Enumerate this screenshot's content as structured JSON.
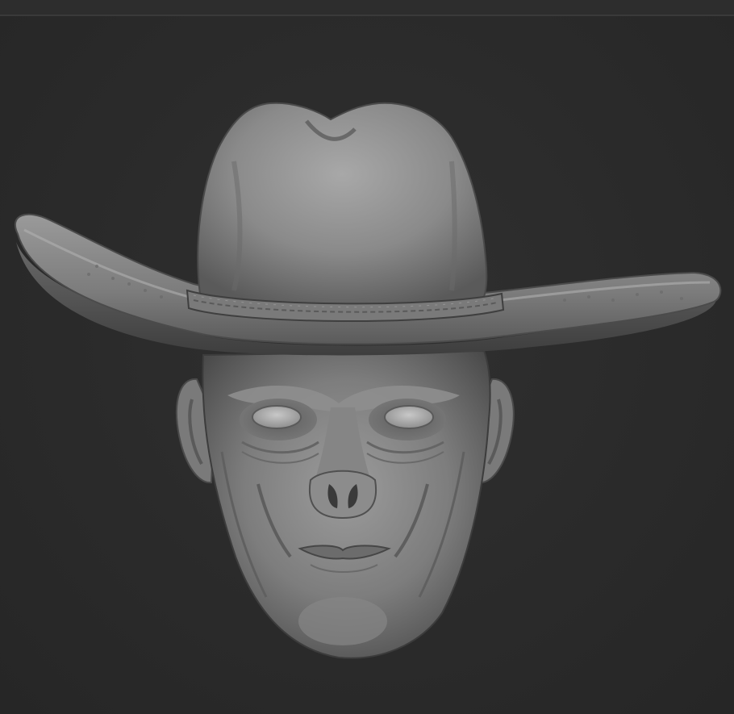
{
  "scene": {
    "subject": "sculpt-render",
    "background_color": "#2b2b2b",
    "material_color": "#8a8a8a"
  }
}
